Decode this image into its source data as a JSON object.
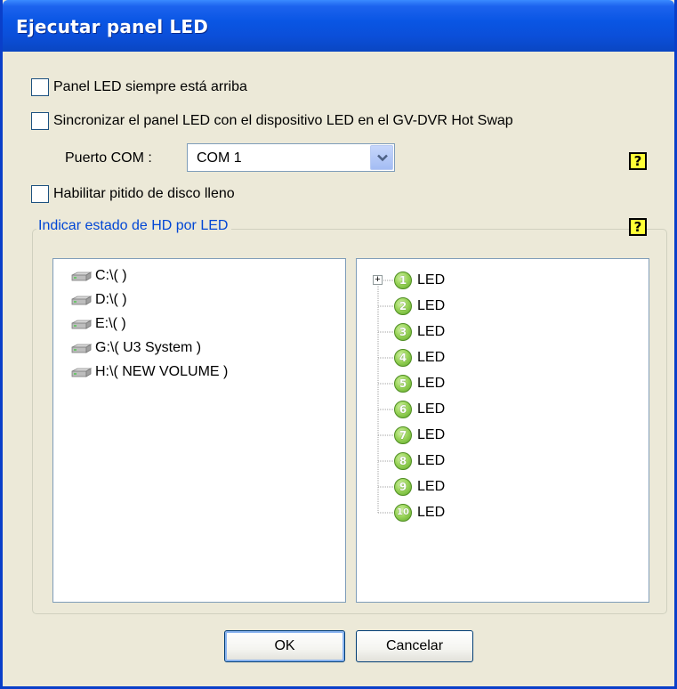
{
  "window": {
    "title": "Ejecutar panel LED"
  },
  "options": {
    "always_on_top": {
      "label": "Panel LED siempre está arriba",
      "checked": false
    },
    "sync_hotswap": {
      "label": "Sincronizar el panel LED con el dispositivo LED en el GV-DVR Hot Swap",
      "checked": false
    },
    "com_port": {
      "label": "Puerto COM :",
      "value": "COM 1"
    },
    "disk_full_beep": {
      "label": "Habilitar pitido de disco lleno",
      "checked": false
    }
  },
  "help": {
    "glyph": "?"
  },
  "hd_group": {
    "title": "Indicar estado de HD por LED",
    "drives": [
      "C:\\( )",
      "D:\\( )",
      "E:\\( )",
      "G:\\( U3 System )",
      "H:\\( NEW VOLUME )"
    ],
    "leds": [
      {
        "num": "1",
        "label": "LED"
      },
      {
        "num": "2",
        "label": "LED"
      },
      {
        "num": "3",
        "label": "LED"
      },
      {
        "num": "4",
        "label": "LED"
      },
      {
        "num": "5",
        "label": "LED"
      },
      {
        "num": "6",
        "label": "LED"
      },
      {
        "num": "7",
        "label": "LED"
      },
      {
        "num": "8",
        "label": "LED"
      },
      {
        "num": "9",
        "label": "LED"
      },
      {
        "num": "10",
        "label": "LED"
      }
    ],
    "expander": "+"
  },
  "buttons": {
    "ok": "OK",
    "cancel": "Cancelar"
  },
  "colors": {
    "titlebar": "#0a56e4",
    "group_title": "#0046d5",
    "help_bg": "#ffff36",
    "led_green": "#9ad45a"
  }
}
